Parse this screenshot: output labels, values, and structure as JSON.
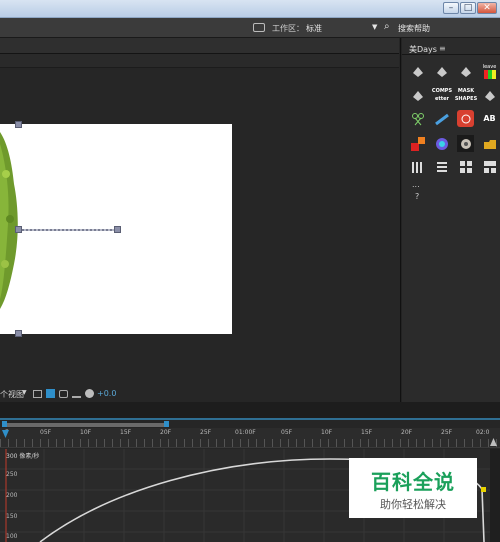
{
  "menubar": {
    "workspace_label": "工作区：",
    "workspace_value": "标准",
    "search_help": "搜索帮助"
  },
  "right_panel": {
    "tab_label": "美Days",
    "menu_icon": "≡",
    "tools": [
      {
        "label": ""
      },
      {
        "label": ""
      },
      {
        "label": ""
      },
      {
        "label": "leave"
      },
      {
        "label": ""
      },
      {
        "label": "COMPS etter"
      },
      {
        "label": "MASK SHAPES"
      },
      {
        "label": ""
      },
      {
        "label": ""
      },
      {
        "label": ""
      },
      {
        "label": ""
      },
      {
        "label": ""
      },
      {
        "label": ""
      },
      {
        "label": ""
      },
      {
        "label": ""
      },
      {
        "label": ""
      },
      {
        "label": ""
      },
      {
        "label": ""
      },
      {
        "label": ""
      },
      {
        "label": ""
      }
    ],
    "more": "...",
    "help": "?"
  },
  "viewer": {
    "view_select": "个视图",
    "exposure": "+0.0"
  },
  "timeline": {
    "ticks": [
      "F",
      "05F",
      "10F",
      "15F",
      "20F",
      "25F",
      "01:00F",
      "05F",
      "10F",
      "15F",
      "20F",
      "25F",
      "02:0"
    ],
    "graph_unit": "300 像素/秒",
    "y_ticks": [
      "250",
      "200",
      "150",
      "100"
    ]
  },
  "watermark": {
    "title": "百科全说",
    "subtitle": "助你轻松解决"
  },
  "colors": {
    "accent": "#2f8fc9",
    "curve": "#d8d8d8",
    "keyframe": "#e8d200"
  }
}
